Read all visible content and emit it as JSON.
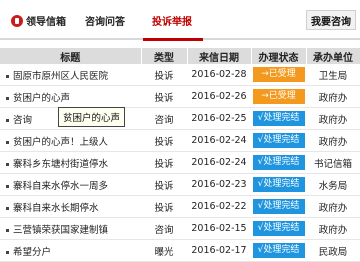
{
  "tabs": [
    {
      "label": "领导信箱",
      "active": false
    },
    {
      "label": "咨询问答",
      "active": false
    },
    {
      "label": "投诉举报",
      "active": true
    }
  ],
  "consult_button": "我要咨询",
  "table": {
    "headers": [
      "标题",
      "类型",
      "来信日期",
      "办理状态",
      "承办单位"
    ],
    "rows": [
      {
        "title": "固原市原州区人民医院",
        "type": "投诉",
        "date": "2016-02-28",
        "status": "→已受理",
        "status_color": "orange",
        "unit": "卫生局"
      },
      {
        "title": "贫困户的心声",
        "type": "投诉",
        "date": "2016-02-26",
        "status": "→已受理",
        "status_color": "orange",
        "unit": "政府办"
      },
      {
        "title": "咨询",
        "type": "咨询",
        "date": "2016-02-25",
        "status": "√处理完结",
        "status_color": "blue",
        "unit": "政府办"
      },
      {
        "title": "贫困户的心声！上级人",
        "type": "投诉",
        "date": "2016-02-24",
        "status": "√处理完结",
        "status_color": "blue",
        "unit": "政府办"
      },
      {
        "title": "寨科乡东塘村街道停水",
        "type": "投诉",
        "date": "2016-02-24",
        "status": "√处理完结",
        "status_color": "blue",
        "unit": "书记信箱"
      },
      {
        "title": "寨科自来水停水一周多",
        "type": "投诉",
        "date": "2016-02-23",
        "status": "√处理完结",
        "status_color": "blue",
        "unit": "水务局"
      },
      {
        "title": "寨科自来水长期停水",
        "type": "投诉",
        "date": "2016-02-22",
        "status": "√处理完结",
        "status_color": "blue",
        "unit": "政府办"
      },
      {
        "title": "三营镇荣获国家建制镇",
        "type": "咨询",
        "date": "2016-02-15",
        "status": "√处理完结",
        "status_color": "blue",
        "unit": "政府办"
      },
      {
        "title": "希望分户",
        "type": "曝光",
        "date": "2016-02-17",
        "status": "√处理完结",
        "status_color": "blue",
        "unit": "民政局"
      }
    ]
  },
  "tooltip": "贫困户的心声",
  "colors": {
    "accent": "#c00000",
    "orange": "#f39a1e",
    "blue": "#1f95e0",
    "header_bg": "#dcdcdc"
  }
}
